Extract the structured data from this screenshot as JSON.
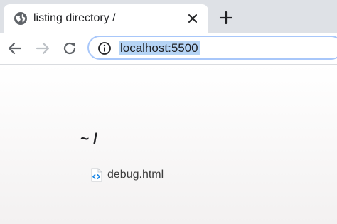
{
  "tab": {
    "title": "listing directory /",
    "favicon": "globe-icon",
    "close": "close-icon"
  },
  "new_tab": "plus-icon",
  "toolbar": {
    "back": "arrow-left-icon",
    "forward": "arrow-right-icon",
    "reload": "reload-icon",
    "site_info": "info-icon"
  },
  "address_bar": {
    "url": "localhost:5500",
    "selection_color": "#b5d4f5",
    "focus_ring_color": "#a8c7fa"
  },
  "listing": {
    "heading": "~ /",
    "files": [
      {
        "name": "debug.html",
        "icon": "html-file-icon"
      }
    ]
  }
}
